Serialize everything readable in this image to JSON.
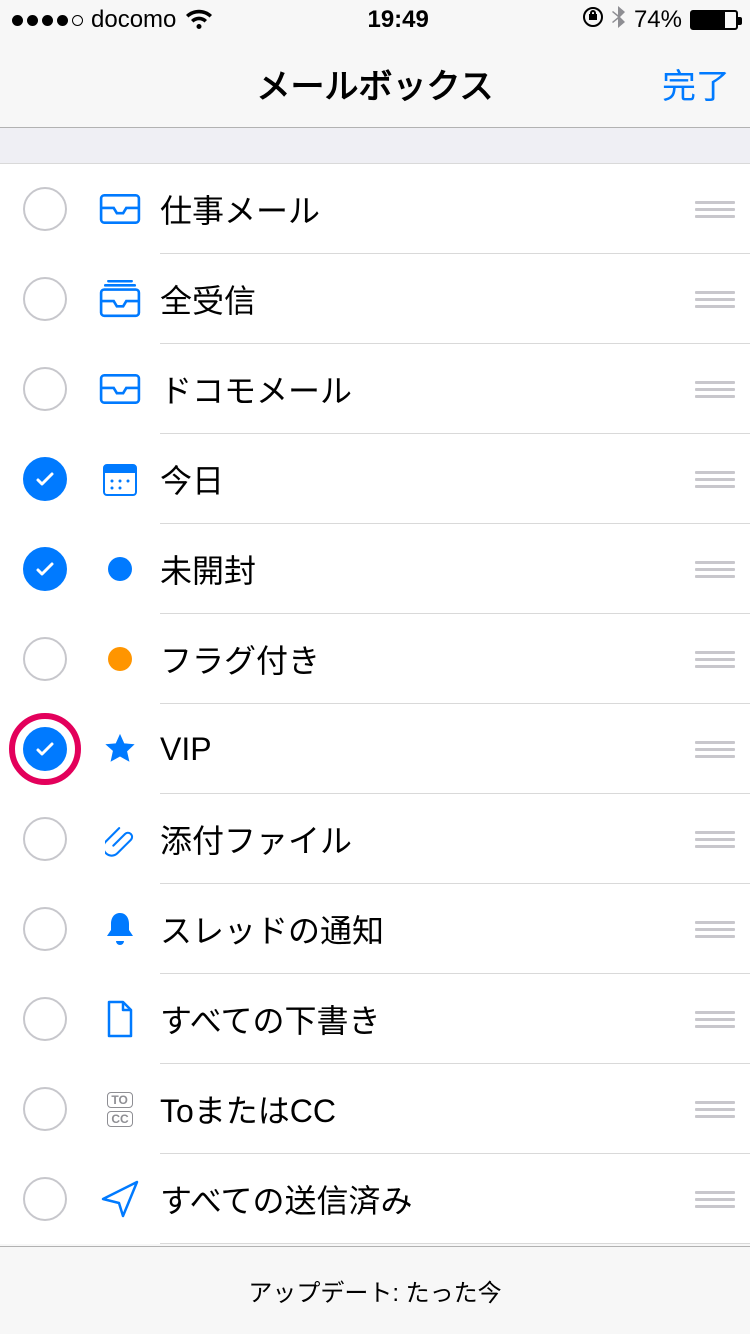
{
  "status": {
    "carrier": "docomo",
    "time": "19:49",
    "battery_pct": "74%"
  },
  "nav": {
    "title": "メールボックス",
    "done": "完了"
  },
  "mailboxes": [
    {
      "label": "仕事メール",
      "checked": false,
      "icon": "inbox",
      "highlight": false
    },
    {
      "label": "全受信",
      "checked": false,
      "icon": "all-inbox",
      "highlight": false
    },
    {
      "label": "ドコモメール",
      "checked": false,
      "icon": "inbox",
      "highlight": false
    },
    {
      "label": "今日",
      "checked": true,
      "icon": "calendar",
      "highlight": false
    },
    {
      "label": "未開封",
      "checked": true,
      "icon": "blue-dot",
      "highlight": false
    },
    {
      "label": "フラグ付き",
      "checked": false,
      "icon": "orange-dot",
      "highlight": false
    },
    {
      "label": "VIP",
      "checked": true,
      "icon": "star",
      "highlight": true
    },
    {
      "label": "添付ファイル",
      "checked": false,
      "icon": "paperclip",
      "highlight": false
    },
    {
      "label": "スレッドの通知",
      "checked": false,
      "icon": "bell",
      "highlight": false
    },
    {
      "label": "すべての下書き",
      "checked": false,
      "icon": "draft",
      "highlight": false
    },
    {
      "label": "ToまたはCC",
      "checked": false,
      "icon": "to-cc",
      "highlight": false
    },
    {
      "label": "すべての送信済み",
      "checked": false,
      "icon": "send",
      "highlight": false
    }
  ],
  "footer": {
    "status": "アップデート: たった今"
  },
  "colors": {
    "tint": "#007aff",
    "orange": "#ff9500",
    "highlight": "#e3005b"
  }
}
